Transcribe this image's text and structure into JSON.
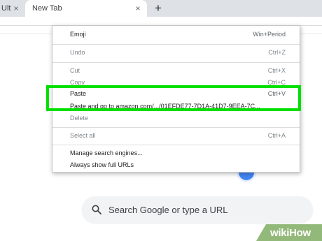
{
  "tabs": [
    {
      "label": "Ult",
      "close": "×"
    },
    {
      "label": "New Tab",
      "close": "×"
    }
  ],
  "new_tab_symbol": "+",
  "search": {
    "placeholder": "Search Google or type a URL"
  },
  "menu": {
    "items": [
      {
        "label": "Emoji",
        "shortcut": "Win+Period",
        "enabled": true
      },
      {
        "label": "Undo",
        "shortcut": "Ctrl+Z",
        "enabled": false
      },
      {
        "label": "Cut",
        "shortcut": "Ctrl+X",
        "enabled": false
      },
      {
        "label": "Copy",
        "shortcut": "Ctrl+C",
        "enabled": false
      },
      {
        "label": "Paste",
        "shortcut": "Ctrl+V",
        "enabled": true
      },
      {
        "label": "Paste and go to amazon.com/.../01EFDE77-7D1A-41D7-9EEA-7C...",
        "shortcut": "",
        "enabled": true
      },
      {
        "label": "Delete",
        "shortcut": "",
        "enabled": false
      },
      {
        "label": "Select all",
        "shortcut": "Ctrl+A",
        "enabled": false
      },
      {
        "label": "Manage search engines...",
        "shortcut": "",
        "enabled": true
      },
      {
        "label": "Always show full URLs",
        "shortcut": "",
        "enabled": true
      }
    ]
  },
  "highlight_color": "#00e000",
  "icons": {
    "search": "search-icon",
    "logo": "wikihow-logo"
  },
  "watermark": "wikiHow"
}
